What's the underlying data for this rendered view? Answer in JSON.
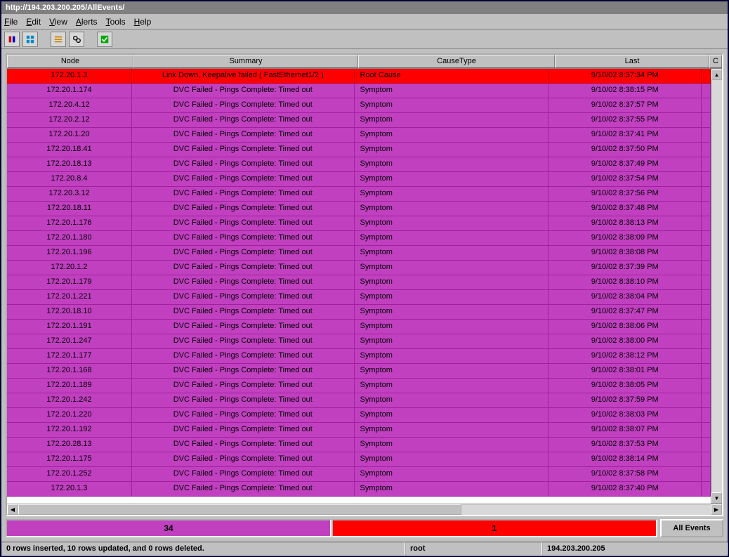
{
  "titlebar": "http://194.203.200.205/AllEvents/",
  "menu": {
    "file": "File",
    "edit": "Edit",
    "view": "View",
    "alerts": "Alerts",
    "tools": "Tools",
    "help": "Help"
  },
  "columns": {
    "c0": "Node",
    "c1": "Summary",
    "c2": "CauseType",
    "c3": "Last",
    "c4": "C"
  },
  "rows": [
    {
      "type": "red",
      "node": "172.20.1.3",
      "summary": "Link Down, Keepalive failed  ( FastEthernet1/2 )",
      "cause": "Root Cause",
      "last": "9/10/02 8:37:34 PM"
    },
    {
      "type": "purple",
      "node": "172.20.1.174",
      "summary": "DVC Failed - Pings Complete: Timed out",
      "cause": "Symptom",
      "last": "9/10/02 8:38:15 PM"
    },
    {
      "type": "purple",
      "node": "172.20.4.12",
      "summary": "DVC Failed - Pings Complete: Timed out",
      "cause": "Symptom",
      "last": "9/10/02 8:37:57 PM"
    },
    {
      "type": "purple",
      "node": "172.20.2.12",
      "summary": "DVC Failed - Pings Complete: Timed out",
      "cause": "Symptom",
      "last": "9/10/02 8:37:55 PM"
    },
    {
      "type": "purple",
      "node": "172.20.1.20",
      "summary": "DVC Failed - Pings Complete: Timed out",
      "cause": "Symptom",
      "last": "9/10/02 8:37:41 PM"
    },
    {
      "type": "purple",
      "node": "172.20.18.41",
      "summary": "DVC Failed - Pings Complete: Timed out",
      "cause": "Symptom",
      "last": "9/10/02 8:37:50 PM"
    },
    {
      "type": "purple",
      "node": "172.20.18.13",
      "summary": "DVC Failed - Pings Complete: Timed out",
      "cause": "Symptom",
      "last": "9/10/02 8:37:49 PM"
    },
    {
      "type": "purple",
      "node": "172.20.8.4",
      "summary": "DVC Failed - Pings Complete: Timed out",
      "cause": "Symptom",
      "last": "9/10/02 8:37:54 PM"
    },
    {
      "type": "purple",
      "node": "172.20.3.12",
      "summary": "DVC Failed - Pings Complete: Timed out",
      "cause": "Symptom",
      "last": "9/10/02 8:37:56 PM"
    },
    {
      "type": "purple",
      "node": "172.20.18.11",
      "summary": "DVC Failed - Pings Complete: Timed out",
      "cause": "Symptom",
      "last": "9/10/02 8:37:48 PM"
    },
    {
      "type": "purple",
      "node": "172.20.1.176",
      "summary": "DVC Failed - Pings Complete: Timed out",
      "cause": "Symptom",
      "last": "9/10/02 8:38:13 PM"
    },
    {
      "type": "purple",
      "node": "172.20.1.180",
      "summary": "DVC Failed - Pings Complete: Timed out",
      "cause": "Symptom",
      "last": "9/10/02 8:38:09 PM"
    },
    {
      "type": "purple",
      "node": "172.20.1.196",
      "summary": "DVC Failed - Pings Complete: Timed out",
      "cause": "Symptom",
      "last": "9/10/02 8:38:08 PM"
    },
    {
      "type": "purple",
      "node": "172.20.1.2",
      "summary": "DVC Failed - Pings Complete: Timed out",
      "cause": "Symptom",
      "last": "9/10/02 8:37:39 PM"
    },
    {
      "type": "purple",
      "node": "172.20.1.179",
      "summary": "DVC Failed - Pings Complete: Timed out",
      "cause": "Symptom",
      "last": "9/10/02 8:38:10 PM"
    },
    {
      "type": "purple",
      "node": "172.20.1.221",
      "summary": "DVC Failed - Pings Complete: Timed out",
      "cause": "Symptom",
      "last": "9/10/02 8:38:04 PM"
    },
    {
      "type": "purple",
      "node": "172.20.18.10",
      "summary": "DVC Failed - Pings Complete: Timed out",
      "cause": "Symptom",
      "last": "9/10/02 8:37:47 PM"
    },
    {
      "type": "purple",
      "node": "172.20.1.191",
      "summary": "DVC Failed - Pings Complete: Timed out",
      "cause": "Symptom",
      "last": "9/10/02 8:38:06 PM"
    },
    {
      "type": "purple",
      "node": "172.20.1.247",
      "summary": "DVC Failed - Pings Complete: Timed out",
      "cause": "Symptom",
      "last": "9/10/02 8:38:00 PM"
    },
    {
      "type": "purple",
      "node": "172.20.1.177",
      "summary": "DVC Failed - Pings Complete: Timed out",
      "cause": "Symptom",
      "last": "9/10/02 8:38:12 PM"
    },
    {
      "type": "purple",
      "node": "172.20.1.168",
      "summary": "DVC Failed - Pings Complete: Timed out",
      "cause": "Symptom",
      "last": "9/10/02 8:38:01 PM"
    },
    {
      "type": "purple",
      "node": "172.20.1.189",
      "summary": "DVC Failed - Pings Complete: Timed out",
      "cause": "Symptom",
      "last": "9/10/02 8:38:05 PM"
    },
    {
      "type": "purple",
      "node": "172.20.1.242",
      "summary": "DVC Failed - Pings Complete: Timed out",
      "cause": "Symptom",
      "last": "9/10/02 8:37:59 PM"
    },
    {
      "type": "purple",
      "node": "172.20.1.220",
      "summary": "DVC Failed - Pings Complete: Timed out",
      "cause": "Symptom",
      "last": "9/10/02 8:38:03 PM"
    },
    {
      "type": "purple",
      "node": "172.20.1.192",
      "summary": "DVC Failed - Pings Complete: Timed out",
      "cause": "Symptom",
      "last": "9/10/02 8:38:07 PM"
    },
    {
      "type": "purple",
      "node": "172.20.28.13",
      "summary": "DVC Failed - Pings Complete: Timed out",
      "cause": "Symptom",
      "last": "9/10/02 8:37:53 PM"
    },
    {
      "type": "purple",
      "node": "172.20.1.175",
      "summary": "DVC Failed - Pings Complete: Timed out",
      "cause": "Symptom",
      "last": "9/10/02 8:38:14 PM"
    },
    {
      "type": "purple",
      "node": "172.20.1.252",
      "summary": "DVC Failed - Pings Complete: Timed out",
      "cause": "Symptom",
      "last": "9/10/02 8:37:58 PM"
    },
    {
      "type": "purple",
      "node": "172.20.1.3",
      "summary": "DVC Failed - Pings Complete: Timed out",
      "cause": "Symptom",
      "last": "9/10/02 8:37:40 PM"
    }
  ],
  "summary": {
    "purple": "34",
    "red": "1",
    "button": "All Events"
  },
  "status": {
    "p0": "0 rows inserted, 10 rows updated, and 0 rows deleted.",
    "p1": "root",
    "p2": "194.203.200.205"
  }
}
